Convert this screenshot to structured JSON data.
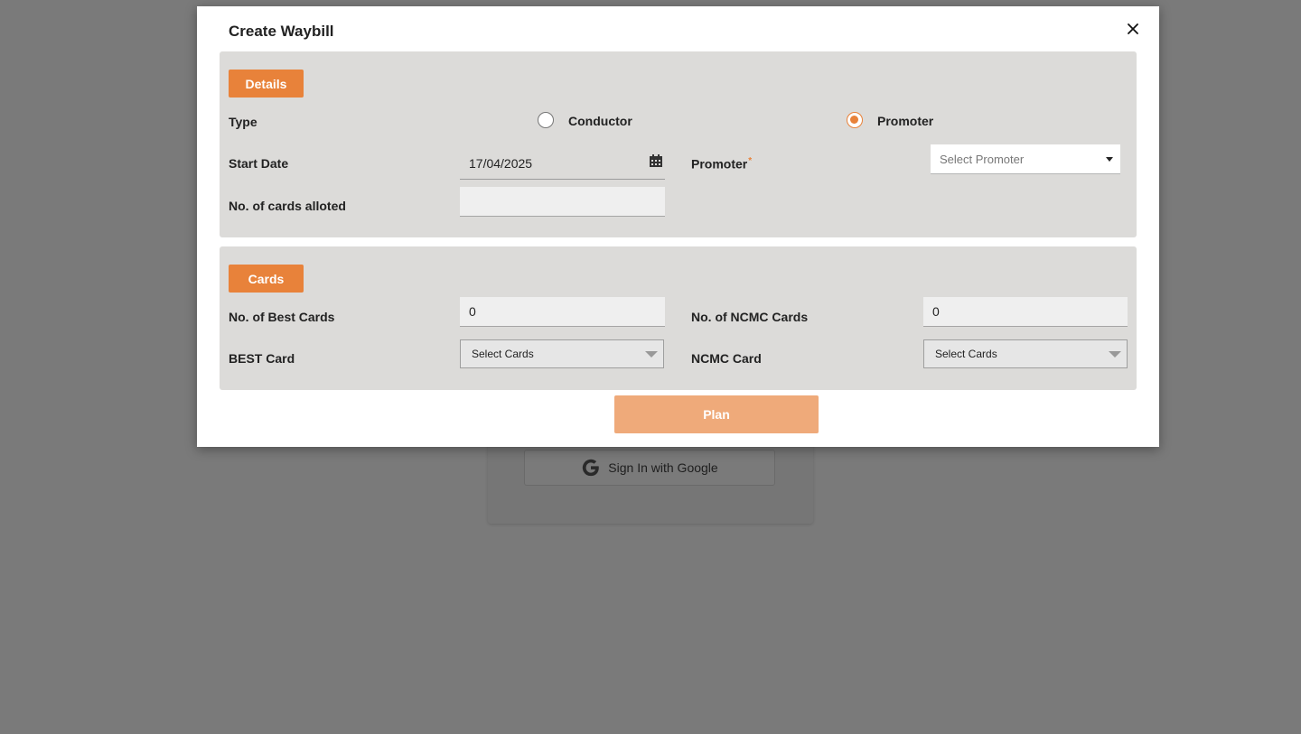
{
  "background": {
    "google_button_label": "Sign In with Google"
  },
  "modal": {
    "title": "Create Waybill",
    "close_icon": "close-icon"
  },
  "details": {
    "section_label": "Details",
    "type_label": "Type",
    "type_options": [
      {
        "label": "Conductor",
        "selected": false
      },
      {
        "label": "Promoter",
        "selected": true
      }
    ],
    "start_date_label": "Start Date",
    "start_date_value": "17/04/2025",
    "promoter_label": "Promoter",
    "promoter_required_mark": "*",
    "promoter_placeholder": "Select Promoter",
    "cards_alloted_label": "No. of cards alloted",
    "cards_alloted_value": ""
  },
  "cards": {
    "section_label": "Cards",
    "best_count_label": "No. of Best Cards",
    "best_count_value": "0",
    "ncmc_count_label": "No. of NCMC Cards",
    "ncmc_count_value": "0",
    "best_card_label": "BEST Card",
    "best_card_placeholder": "Select Cards",
    "ncmc_card_label": "NCMC Card",
    "ncmc_card_placeholder": "Select Cards"
  },
  "actions": {
    "plan_label": "Plan"
  },
  "colors": {
    "accent": "#e8823a",
    "accent_disabled": "#efaa7a",
    "panel_bg": "#dcdbd9",
    "overlay": "#7a7a7a"
  }
}
